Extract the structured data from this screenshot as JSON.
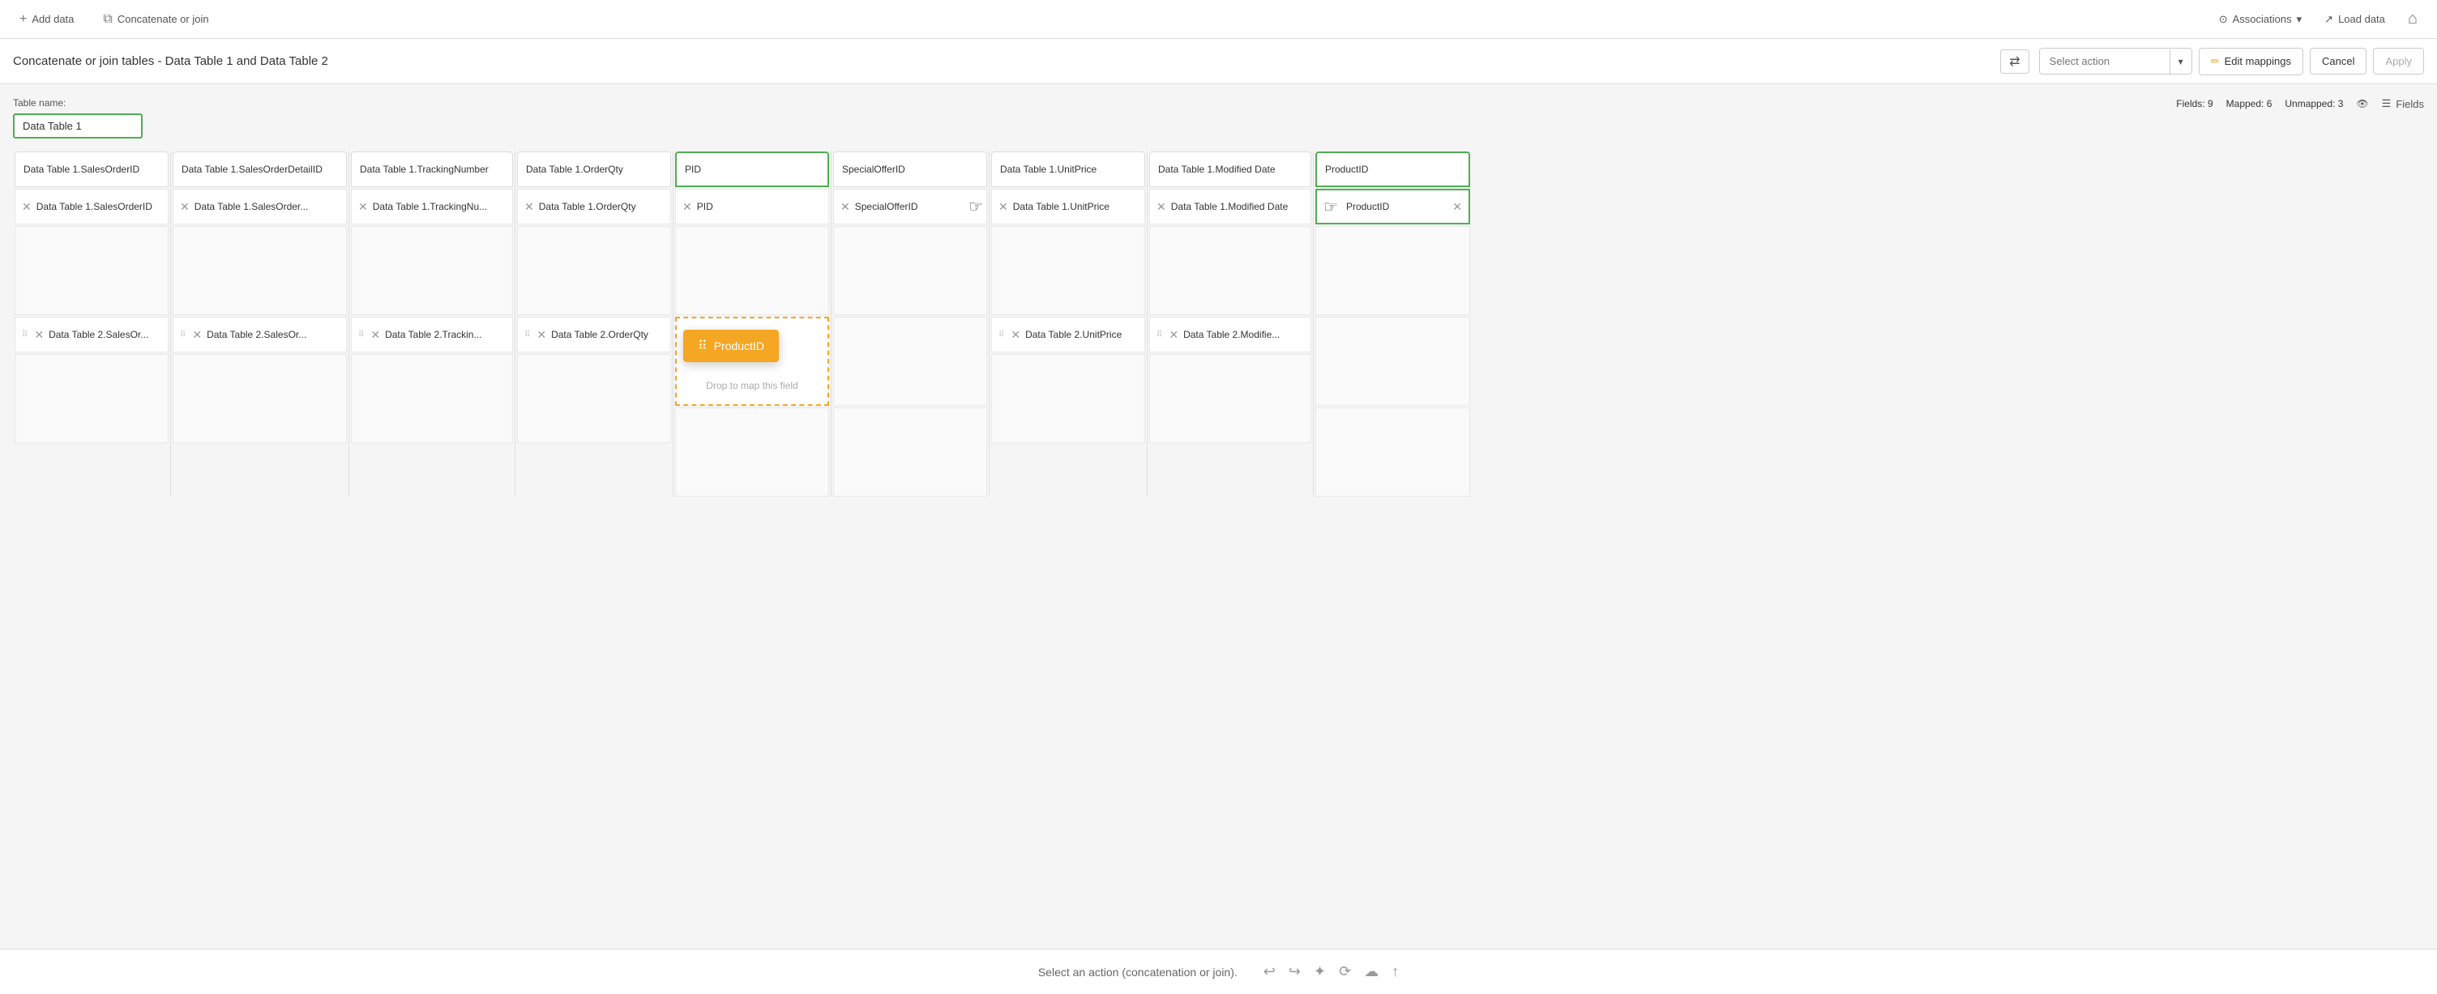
{
  "toolbar": {
    "add_data_label": "Add data",
    "concat_join_label": "Concatenate or join",
    "associations_label": "Associations",
    "load_data_label": "Load data",
    "home_icon": "⌂"
  },
  "action_bar": {
    "title": "Concatenate or join tables - Data Table 1 and Data Table 2",
    "swap_icon": "⇄",
    "select_action_placeholder": "Select action",
    "edit_mappings_label": "Edit mappings",
    "cancel_label": "Cancel",
    "apply_label": "Apply"
  },
  "table_name": {
    "label": "Table name:",
    "value": "Data Table 1"
  },
  "fields_summary": {
    "fields_count": "Fields: 9",
    "mapped_count": "Mapped: 6",
    "unmapped_count": "Unmapped: 3",
    "fields_label": "Fields"
  },
  "columns": [
    {
      "header": "Data Table 1.SalesOrderID",
      "row1": "Data Table 1.SalesOrderID",
      "row2": "Data Table 2.SalesOr..."
    },
    {
      "header": "Data Table 1.SalesOrderDetailID",
      "row1": "Data Table 1.SalesOrder...",
      "row2": "Data Table 2.SalesOr..."
    },
    {
      "header": "Data Table 1.TrackingNumber",
      "row1": "Data Table 1.TrackingNu...",
      "row2": "Data Table 2.Trackin..."
    },
    {
      "header": "Data Table 1.OrderQty",
      "row1": "Data Table 1.OrderQty",
      "row2": "Data Table 2.OrderQty"
    },
    {
      "header": "PID",
      "row1": "PID",
      "row2": null,
      "highlighted": true,
      "drop_target": true,
      "drag_label": "ProductID",
      "drop_text": "Drop to map this field"
    },
    {
      "header": "SpecialOfferID",
      "row1": "SpecialOfferID",
      "row2": null,
      "has_cursor": true
    },
    {
      "header": "Data Table 1.UnitPrice",
      "row1": "Data Table 1.UnitPrice",
      "row2": "Data Table 2.UnitPrice"
    },
    {
      "header": "Data Table 1.Modified Date",
      "row1": "Data Table 1.Modified Date",
      "row2": "Data Table 2.Modifie..."
    },
    {
      "header": "ProductID",
      "row1": "ProductID",
      "row2": null,
      "highlighted": true,
      "last_highlighted": true
    }
  ],
  "status_bar": {
    "text": "Select an action (concatenation or join).",
    "icons": [
      "↩",
      "↪",
      "✦",
      "⟳",
      "☁",
      "↑"
    ]
  },
  "colors": {
    "green_border": "#4caf50",
    "orange_drag": "#f5a623",
    "orange_drag_border": "#f5a623"
  }
}
